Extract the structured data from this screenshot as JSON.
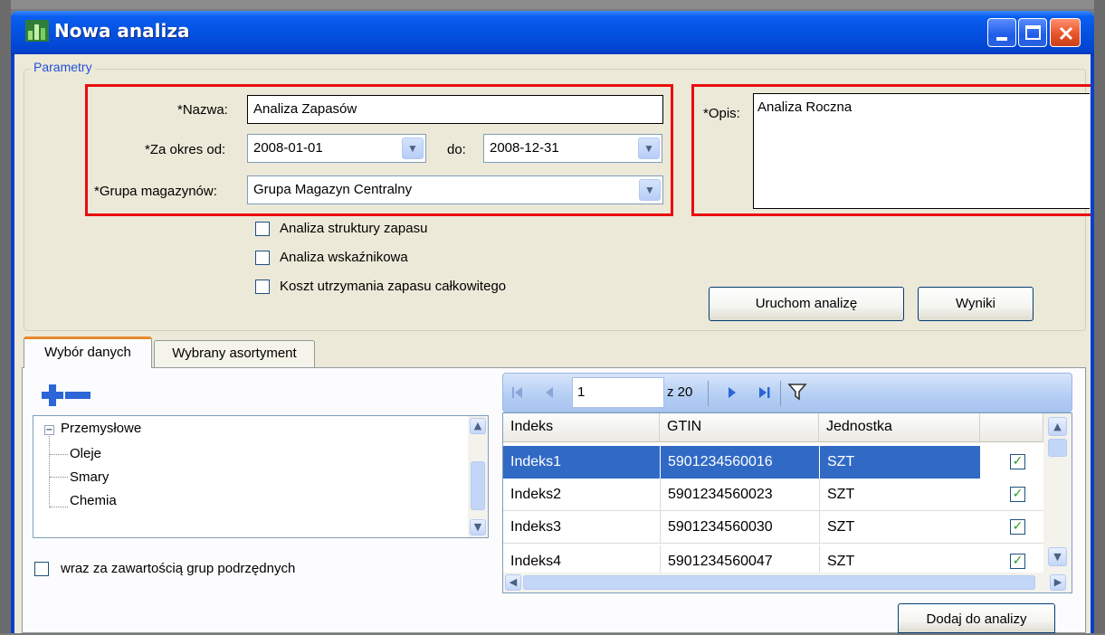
{
  "window": {
    "title": "Nowa analiza"
  },
  "params": {
    "legend": "Parametry",
    "name_label": "*Nazwa:",
    "name_value": "Analiza Zapasów",
    "period_from_label": "*Za okres od:",
    "period_from_value": "2008-01-01",
    "period_to_label": "do:",
    "period_to_value": "2008-12-31",
    "group_label": "*Grupa magazynów:",
    "group_value": "Grupa Magazyn Centralny",
    "desc_label": "*Opis:",
    "desc_value": "Analiza Roczna",
    "checkboxes": [
      {
        "label": "Analiza struktury zapasu",
        "checked": false
      },
      {
        "label": "Analiza wskaźnikowa",
        "checked": false
      },
      {
        "label": "Koszt utrzymania zapasu całkowitego",
        "checked": false
      }
    ],
    "run_button": "Uruchom analizę",
    "results_button": "Wyniki"
  },
  "tabs": [
    {
      "label": "Wybór danych",
      "active": true
    },
    {
      "label": "Wybrany asortyment",
      "active": false
    }
  ],
  "tree": {
    "root": "Przemysłowe",
    "children": [
      "Oleje",
      "Smary",
      "Chemia"
    ]
  },
  "subgroups_checkbox": {
    "label": "wraz za zawartością grup podrzędnych",
    "checked": false
  },
  "pager": {
    "page_value": "1",
    "total_text": "z 20"
  },
  "grid": {
    "columns": [
      "Indeks",
      "GTIN",
      "Jednostka"
    ],
    "rows": [
      {
        "indeks": "Indeks1",
        "gtin": "5901234560016",
        "jednostka": "SZT",
        "checked": true,
        "selected": true
      },
      {
        "indeks": "Indeks2",
        "gtin": "5901234560023",
        "jednostka": "SZT",
        "checked": true,
        "selected": false
      },
      {
        "indeks": "Indeks3",
        "gtin": "5901234560030",
        "jednostka": "SZT",
        "checked": true,
        "selected": false
      },
      {
        "indeks": "Indeks4",
        "gtin": "5901234560047",
        "jednostka": "SZT",
        "checked": true,
        "selected": false
      }
    ]
  },
  "add_button": "Dodaj do analizy",
  "colors": {
    "highlight": "#ea0d0d",
    "selection": "#316ac5",
    "titlebar": "#0451e0",
    "tab_accent": "#e68b2c"
  }
}
